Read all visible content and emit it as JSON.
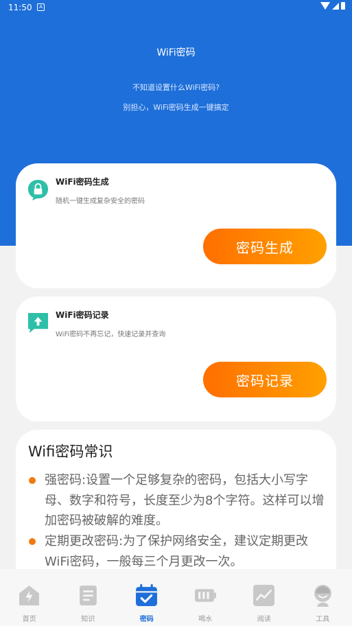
{
  "status_bar": {
    "time": "11:50",
    "notif_icon": "A"
  },
  "hero": {
    "title": "WiFi密码",
    "subtitle1": "不知道设置什么WiFi密码?",
    "subtitle2": "别担心，WiFi密码生成一键搞定"
  },
  "cards": [
    {
      "title": "WiFi密码生成",
      "subtitle": "随机一键生成复杂安全的密码",
      "button": "密码生成",
      "icon": "lock-icon"
    },
    {
      "title": "WiFi密码记录",
      "subtitle": "WiFi密码不再忘记，快速记录并查询",
      "button": "密码记录",
      "icon": "upload-icon"
    }
  ],
  "knowledge": {
    "title": "Wifi密码常识",
    "items": [
      "强密码:设置一个足够复杂的密码，包括大小写字母、数字和符号，长度至少为8个字符。这样可以增加密码被破解的难度。",
      "定期更改密码:为了保护网络安全，建议定期更改 WiFi密码，一般每三个月更改一次。"
    ]
  },
  "tabs": [
    {
      "label": "首页",
      "icon": "home-icon",
      "active": false
    },
    {
      "label": "知识",
      "icon": "document-icon",
      "active": false
    },
    {
      "label": "密码",
      "icon": "calendar-check-icon",
      "active": true
    },
    {
      "label": "喝水",
      "icon": "battery-icon",
      "active": false
    },
    {
      "label": "阅读",
      "icon": "chart-icon",
      "active": false
    },
    {
      "label": "工具",
      "icon": "person-icon",
      "active": false
    }
  ],
  "colors": {
    "primary": "#1e6fd9",
    "accent_orange": "#ff7a00",
    "teal": "#2dbfa7"
  }
}
